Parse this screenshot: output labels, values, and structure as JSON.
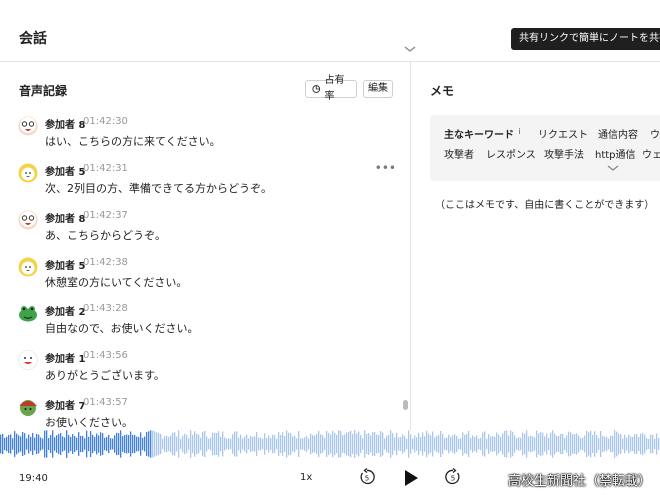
{
  "header": {
    "title": "会話",
    "tooltip": "共有リンクで簡単にノートを共有し"
  },
  "transcript": {
    "title": "音声記録",
    "share_label": "占有率",
    "edit_label": "編集",
    "entries": [
      {
        "speaker": "参加者 8",
        "time": "01:42:30",
        "text": "はい、こちらの方に来てください。",
        "avatar": "glasses-face"
      },
      {
        "speaker": "参加者 5",
        "time": "01:42:31",
        "text": "次、2列目の方、準備できてる方からどうぞ。",
        "avatar": "blonde-face"
      },
      {
        "speaker": "参加者 8",
        "time": "01:42:37",
        "text": "あ、こちらからどうぞ。",
        "avatar": "glasses-face"
      },
      {
        "speaker": "参加者 5",
        "time": "01:42:38",
        "text": "休憩室の方にいてください。",
        "avatar": "blonde-face"
      },
      {
        "speaker": "参加者 2",
        "time": "01:43:28",
        "text": "自由なので、お使いください。",
        "avatar": "frog-face"
      },
      {
        "speaker": "参加者 1",
        "time": "01:43:56",
        "text": "ありがとうございます。",
        "avatar": "white-face"
      },
      {
        "speaker": "参加者 7",
        "time": "01:43:57",
        "text": "お使いください。",
        "avatar": "cap-face"
      }
    ],
    "more_label": "•••"
  },
  "memo": {
    "title": "メモ",
    "keywords_label": "主なキーワード",
    "info_label": "i",
    "keywords_row1": [
      "リクエスト",
      "通信内容",
      "ウ"
    ],
    "keywords_row2": [
      "攻撃者",
      "レスポンス",
      "攻撃手法",
      "http通信",
      "ウェ"
    ],
    "placeholder": "（ここはメモです、自由に書くことができます）"
  },
  "player": {
    "time": "19:40",
    "speed": "1x",
    "rewind_label": "5",
    "forward_label": "5",
    "progress": 0.23,
    "played_color": "#3f7fe0",
    "unplayed_color": "#a9c6ef"
  },
  "watermark": "高校生新聞社（禁転載）"
}
